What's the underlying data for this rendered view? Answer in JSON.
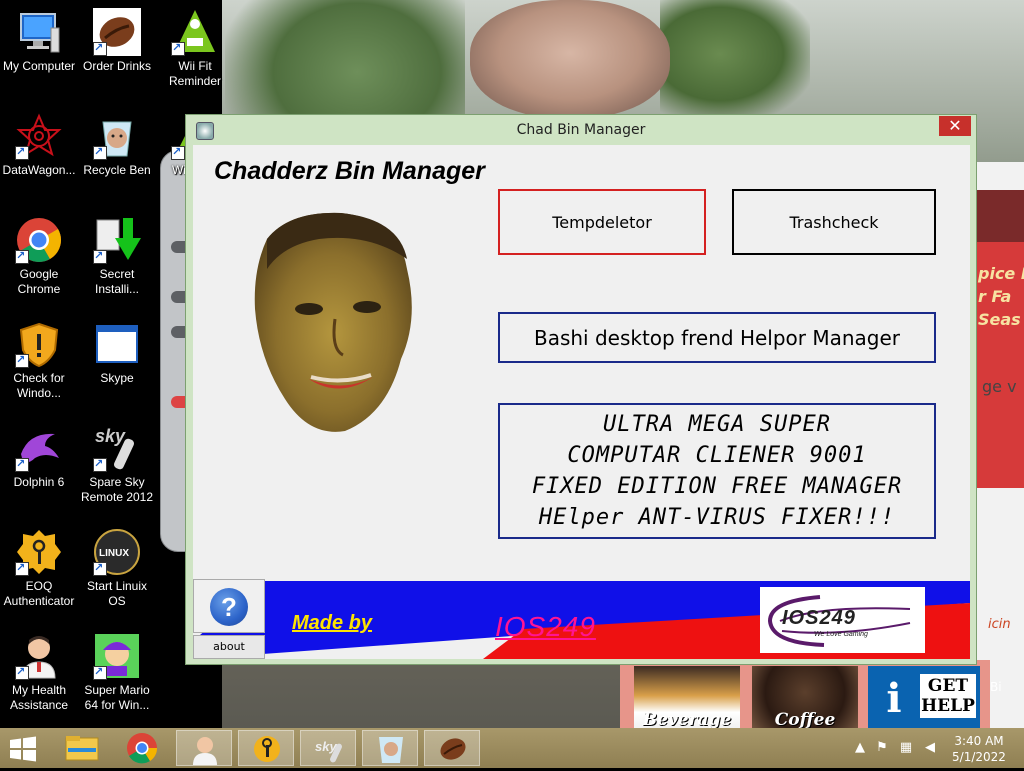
{
  "desktop": {
    "icons": [
      {
        "label": "My Computer"
      },
      {
        "label": "Order Drinks"
      },
      {
        "label": "Wii Fit Reminder"
      },
      {
        "label": "DataWagon..."
      },
      {
        "label": "Recycle Ben"
      },
      {
        "label": "Wii Ge..."
      },
      {
        "label": "Google Chrome"
      },
      {
        "label": "Secret Installi..."
      },
      {
        "label": "Check for Windo..."
      },
      {
        "label": "Skype"
      },
      {
        "label": "Dolphin 6"
      },
      {
        "label": "Spare Sky Remote 2012"
      },
      {
        "label": "EOQ Authenticator"
      },
      {
        "label": "Start Linuix OS"
      },
      {
        "label": "My Health Assistance"
      },
      {
        "label": "Super Mario 64 for Win..."
      }
    ]
  },
  "window": {
    "title": "Chad Bin Manager",
    "close_label": "✕",
    "heading": "Chadderz Bin Manager",
    "buttons": {
      "tempdeletor": "Tempdeletor",
      "trashcheck": "Trashcheck",
      "bashi": "Bashi desktop frend Helpor Manager",
      "ultra": [
        "ULTRA MEGA SUPER",
        "COMPUTAR CLIENER 9001",
        "FIXED EDITION FREE MANAGER",
        "HElper ANT-VIRUS FIXER!!!"
      ]
    },
    "help_glyph": "?",
    "about_label": "about",
    "banner": {
      "made_by": "Made by",
      "author": "IOS249",
      "logo_text": "IOS249",
      "logo_sub": "We Love Gaming"
    },
    "colors": {
      "red_border": "#d42020",
      "navy_border": "#1a2a8a",
      "banner_blue": "#1010e8",
      "banner_red": "#ee1111"
    }
  },
  "background": {
    "right_window_text": [
      "pice F",
      "r Fa",
      "Seas"
    ],
    "right_window_text2": "ge v",
    "right_window_text3": "icin",
    "right_window_text4": "Bi",
    "tiles": {
      "beverage": "Beverage",
      "coffee": "Coffee",
      "help": "GET HELP",
      "help_icon": "i"
    }
  },
  "taskbar": {
    "time": "3:40 AM",
    "date": "5/1/2022"
  }
}
